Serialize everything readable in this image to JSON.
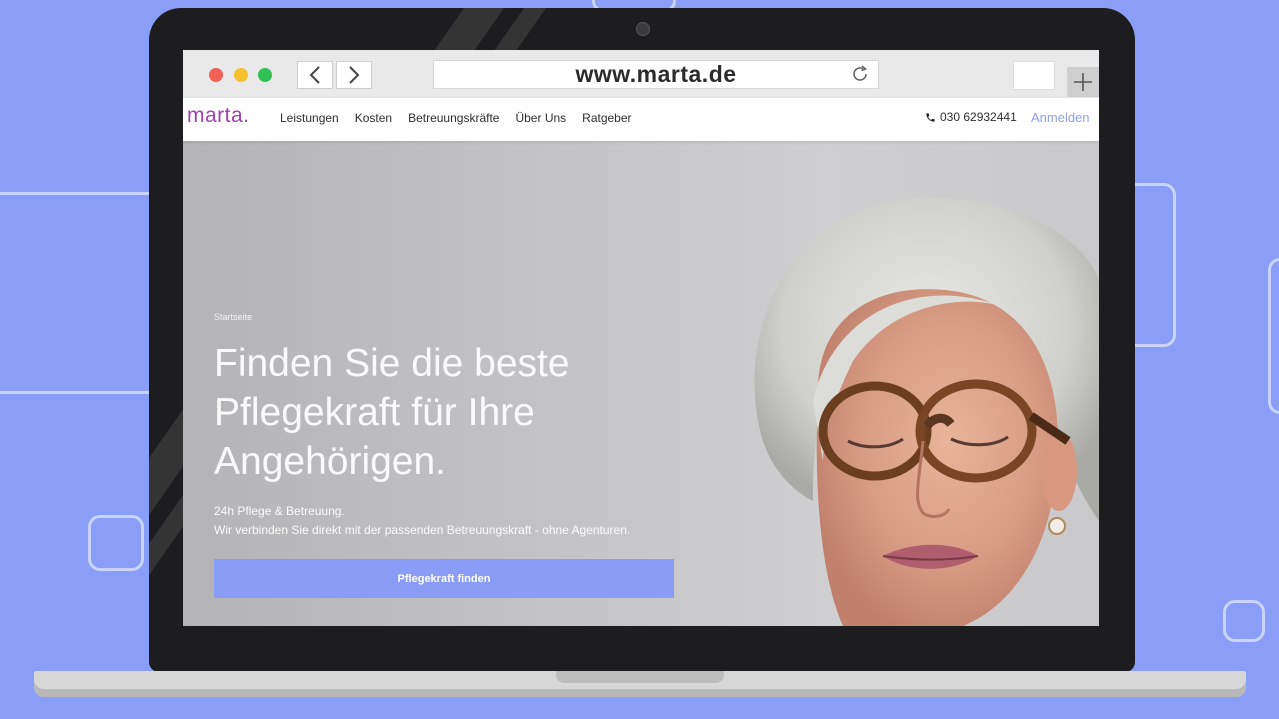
{
  "browser": {
    "url": "www.marta.de",
    "traffic_lights": [
      "#f26158",
      "#f5c12e",
      "#2fc153"
    ]
  },
  "site": {
    "logo": "marta.",
    "brand_color": "#a13fb4",
    "accent_color": "#8b9cf7",
    "nav_items": [
      "Leistungen",
      "Kosten",
      "Betreuungskräfte",
      "Über Uns",
      "Ratgeber"
    ],
    "phone": "030 62932441",
    "login_label": "Anmelden"
  },
  "hero": {
    "breadcrumb": "Startseite",
    "headline_lines": [
      "Finden Sie die beste",
      "Pflegekraft für Ihre",
      "Angehörigen."
    ],
    "sub_lines": [
      "24h Pflege & Betreuung.",
      "Wir verbinden Sie direkt mit der passenden Betreuungskraft - ohne Agenturen."
    ],
    "cta_label": "Pflegekraft finden",
    "image": "elderly-woman-with-glasses-photo"
  }
}
